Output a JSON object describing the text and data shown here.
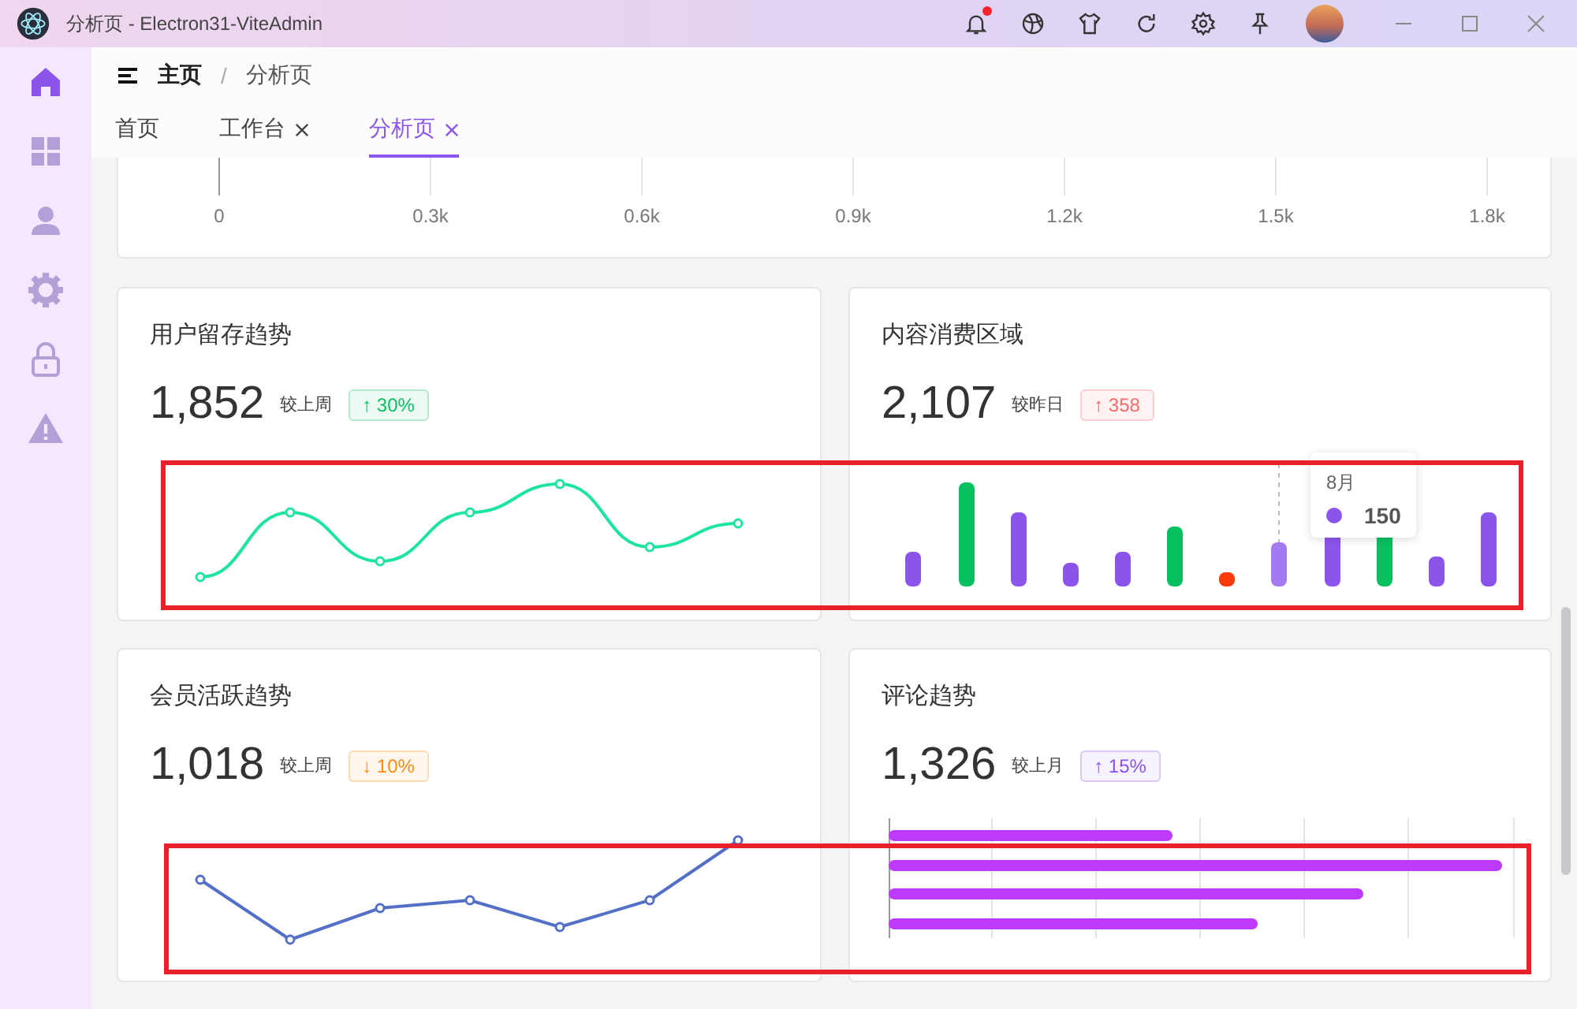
{
  "window": {
    "title": "分析页 - Electron31-ViteAdmin",
    "notification_dot": true
  },
  "sidebar": {
    "items": [
      {
        "selected": true
      },
      {
        "selected": false
      },
      {
        "selected": false
      },
      {
        "selected": false
      },
      {
        "selected": false
      },
      {
        "selected": false
      }
    ]
  },
  "breadcrumb": [
    "主页",
    "/",
    "分析页"
  ],
  "tabs": [
    {
      "label": "首页",
      "closable": false,
      "selected": false
    },
    {
      "label": "工作台",
      "closable": true,
      "selected": false
    },
    {
      "label": "分析页",
      "closable": true,
      "selected": true
    }
  ],
  "top_chart": {
    "axis_labels": [
      "0",
      "0.3k",
      "0.6k",
      "0.9k",
      "1.2k",
      "1.5k",
      "1.8k"
    ]
  },
  "cards": [
    {
      "title": "用户留存趋势",
      "value": "1,852",
      "compare": "较上周",
      "badge": "↑ 30%",
      "color": "#07c160",
      "kind": "smooth-line"
    },
    {
      "title": "内容消费区域",
      "value": "2,107",
      "compare": "较昨日",
      "badge": "↑ 358",
      "color": "#f56c6c",
      "kind": "bars",
      "tooltip": {
        "label": "8月",
        "value": "150"
      }
    },
    {
      "title": "会员活跃趋势",
      "value": "1,018",
      "compare": "较上周",
      "badge": "↓ 10%",
      "color": "#fa8c16",
      "kind": "line"
    },
    {
      "title": "评论趋势",
      "value": "1,326",
      "compare": "较上月",
      "badge": "↑ 15%",
      "color": "#8b55ec",
      "kind": "hbars"
    }
  ]
}
